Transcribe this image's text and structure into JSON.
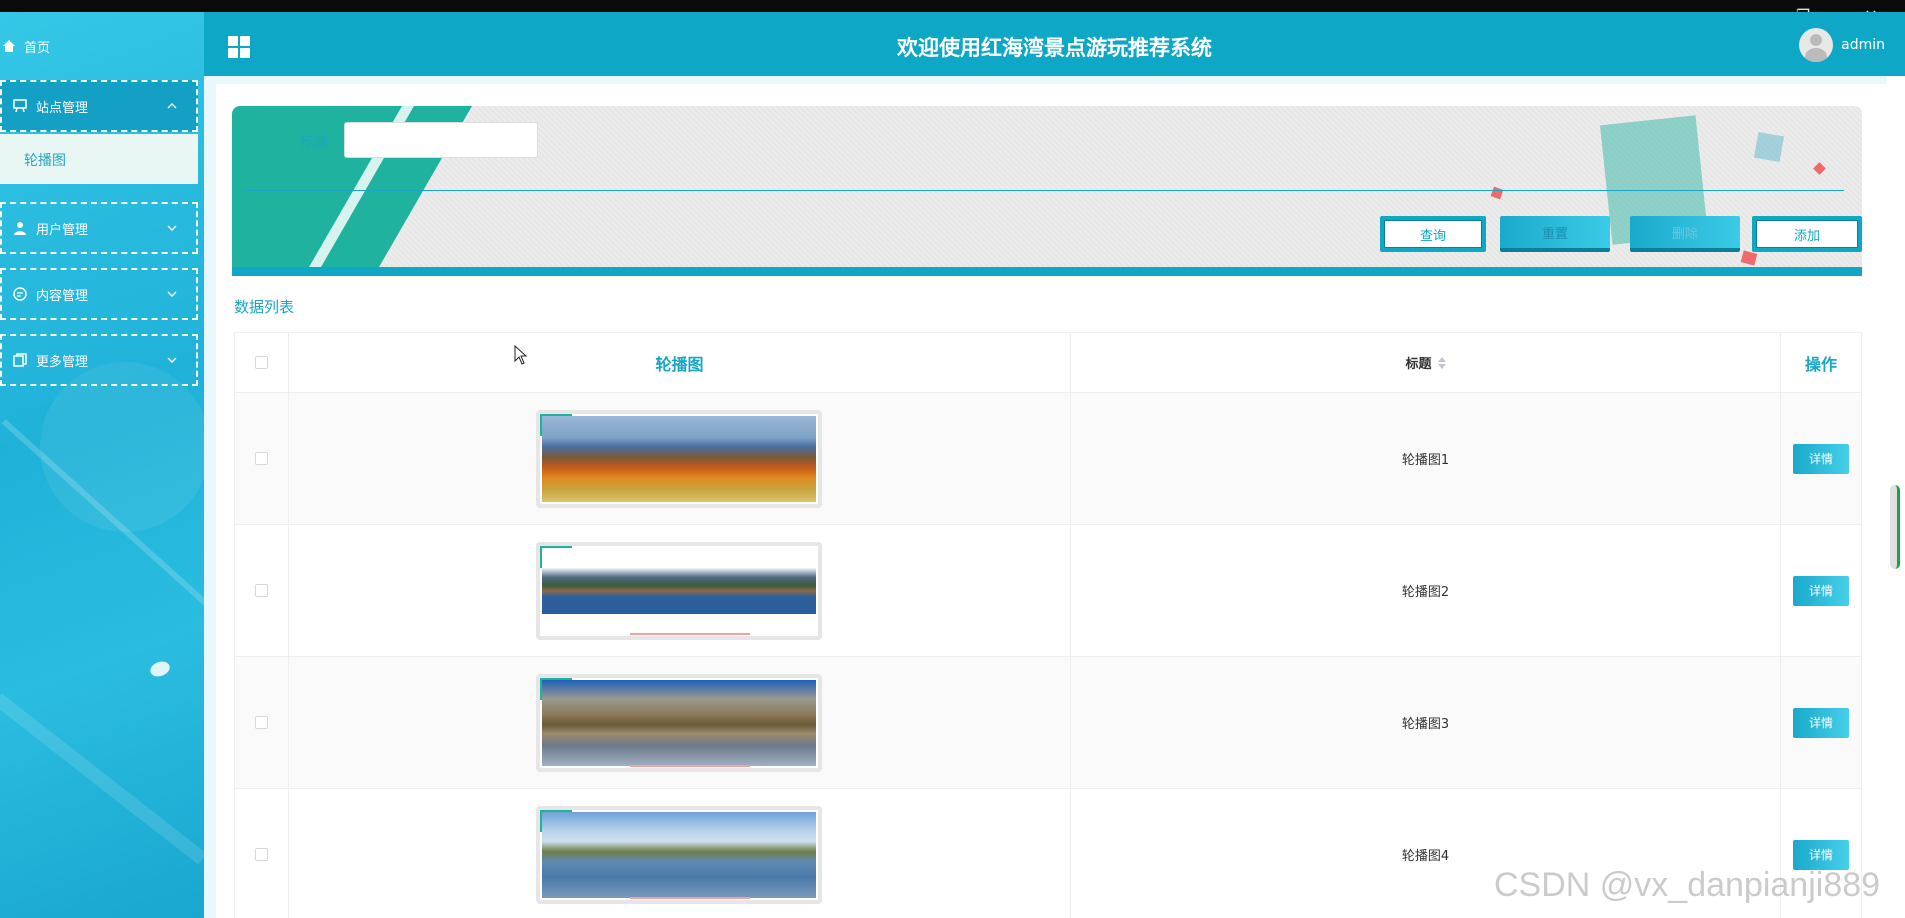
{
  "window_controls": {
    "minimize": "—",
    "restore": "❐",
    "close": "✕"
  },
  "sidebar": {
    "home": "首页",
    "groups": [
      {
        "label": "站点管理",
        "expanded": true,
        "sub": [
          "轮播图"
        ]
      },
      {
        "label": "用户管理",
        "expanded": false
      },
      {
        "label": "内容管理",
        "expanded": false
      },
      {
        "label": "更多管理",
        "expanded": false
      }
    ]
  },
  "header": {
    "title": "欢迎使用红海湾景点游玩推荐系统",
    "user": "admin"
  },
  "search": {
    "label": "标题",
    "value": "",
    "placeholder": "",
    "buttons": {
      "query": "查询",
      "reset": "重置",
      "delete": "删除",
      "add": "添加"
    }
  },
  "list": {
    "title": "数据列表",
    "columns": [
      "轮播图",
      "标题",
      "操作"
    ],
    "rows": [
      {
        "name": "轮播图1",
        "action": "详情"
      },
      {
        "name": "轮播图2",
        "action": "详情"
      },
      {
        "name": "轮播图3",
        "action": "详情"
      },
      {
        "name": "轮播图4",
        "action": "详情"
      }
    ]
  },
  "watermark": "CSDN @vx_danpianji889",
  "colors": {
    "accent": "#0ea7c6",
    "sidebar": "#2bbde0",
    "banner_teal": "#1fb29e"
  }
}
